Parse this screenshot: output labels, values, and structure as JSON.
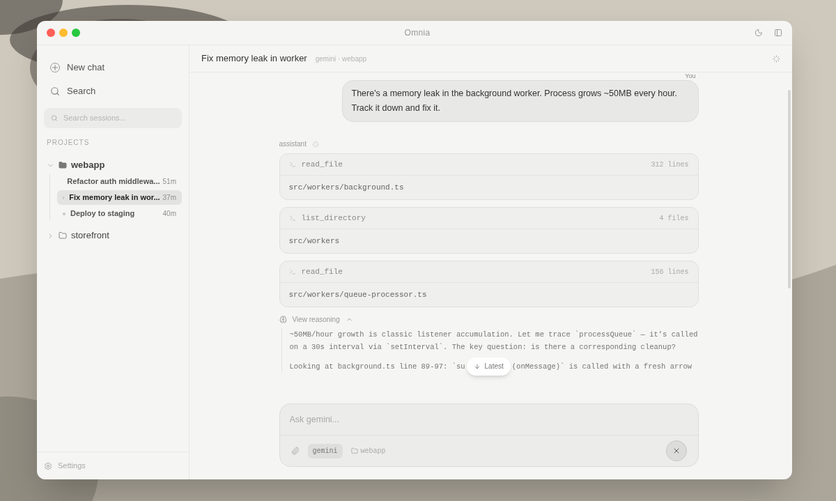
{
  "window": {
    "title": "Omnia"
  },
  "sidebar": {
    "actions": [
      {
        "kind": "new",
        "label": "New chat"
      },
      {
        "kind": "search",
        "label": "Search"
      }
    ],
    "search": {
      "placeholder": "Search sessions..."
    },
    "section_label": "PROJECTS",
    "projects": [
      {
        "name": "webapp",
        "expanded": true,
        "children": [
          {
            "title": "Refactor auth middlewa...",
            "age": "51m",
            "selected": false,
            "dot": false
          },
          {
            "title": "Fix memory leak in wor...",
            "age": "37m",
            "selected": true,
            "dot": true
          },
          {
            "title": "Deploy to staging",
            "age": "40m",
            "selected": false,
            "dot": true
          }
        ]
      },
      {
        "name": "storefront",
        "expanded": false
      }
    ],
    "settings": "Settings"
  },
  "header": {
    "title": "Fix memory leak in worker",
    "subtitle": "gemini · webapp"
  },
  "messages": [
    {
      "kind": "user",
      "author": "You",
      "text": "There's a memory leak in the background worker. Process grows ~50MB every hour. Track it down and fix it."
    },
    {
      "kind": "assistant",
      "author": "assistant",
      "tools": [
        {
          "name": "read_file",
          "meta": "312 lines",
          "arg": "src/workers/background.ts"
        },
        {
          "name": "list_directory",
          "meta": "4 files",
          "arg": "src/workers"
        },
        {
          "name": "read_file",
          "meta": "156 lines",
          "arg": "src/workers/queue-processor.ts"
        }
      ],
      "reasoning": {
        "label": "View reasoning",
        "expanded": true,
        "paragraphs": [
          "~50MB/hour growth is classic listener accumulation. Let me trace `processQueue` — it's called on a 30s interval via `setInterval`. The key question: is there a corresponding cleanup?"
        ],
        "last_line": [
          "Looking at background.ts line 89-97: `su",
          "(onMessage)` is called with a fresh arrow"
        ]
      }
    }
  ],
  "latest_button": "Latest",
  "composer": {
    "placeholder": "Ask gemini...",
    "model": "gemini",
    "project": "webapp"
  }
}
